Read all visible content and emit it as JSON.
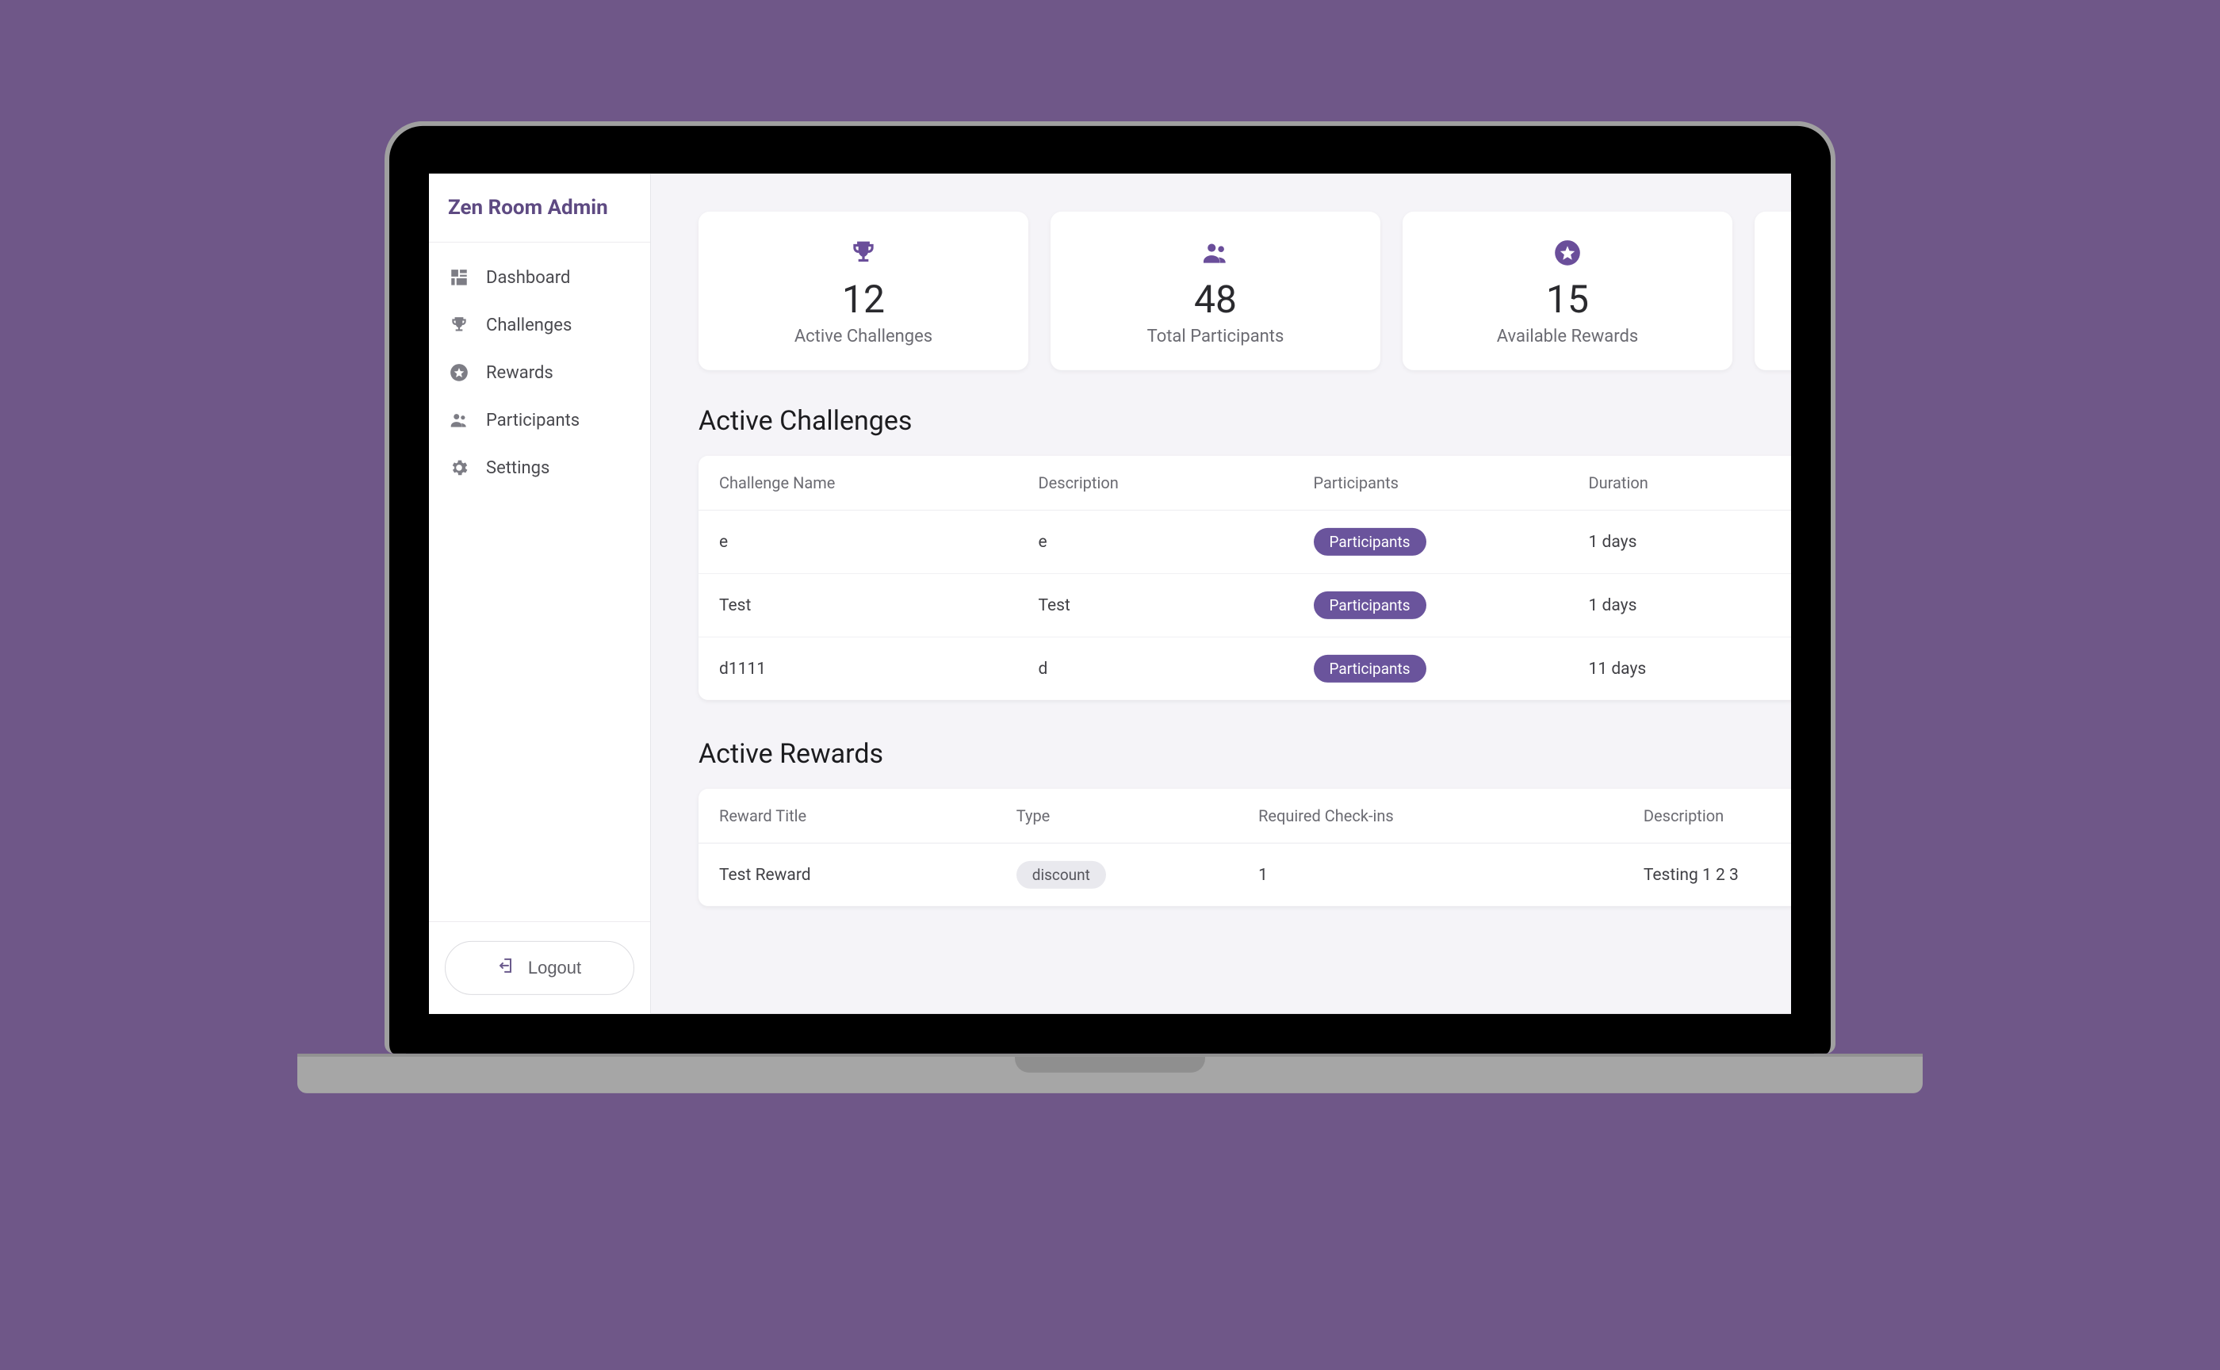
{
  "sidebar": {
    "title": "Zen Room Admin",
    "items": [
      {
        "label": "Dashboard",
        "icon": "dashboard-icon"
      },
      {
        "label": "Challenges",
        "icon": "trophy-icon"
      },
      {
        "label": "Rewards",
        "icon": "star-icon"
      },
      {
        "label": "Participants",
        "icon": "users-icon"
      },
      {
        "label": "Settings",
        "icon": "gear-icon"
      }
    ],
    "logout_label": "Logout"
  },
  "stats": [
    {
      "value": "12",
      "label": "Active Challenges",
      "icon": "trophy-icon"
    },
    {
      "value": "48",
      "label": "Total Participants",
      "icon": "users-icon"
    },
    {
      "value": "15",
      "label": "Available Rewards",
      "icon": "star-icon"
    }
  ],
  "challenges_section": {
    "title": "Active Challenges",
    "columns": {
      "name": "Challenge Name",
      "description": "Description",
      "participants": "Participants",
      "duration": "Duration"
    },
    "rows": [
      {
        "name": "e",
        "description": "e",
        "participants_label": "Participants",
        "duration": "1 days"
      },
      {
        "name": "Test",
        "description": "Test",
        "participants_label": "Participants",
        "duration": "1 days"
      },
      {
        "name": "d1111",
        "description": "d",
        "participants_label": "Participants",
        "duration": "11 days"
      }
    ]
  },
  "rewards_section": {
    "title": "Active Rewards",
    "columns": {
      "title": "Reward Title",
      "type": "Type",
      "checkins": "Required Check-ins",
      "description": "Description"
    },
    "rows": [
      {
        "title": "Test Reward",
        "type": "discount",
        "checkins": "1",
        "description": "Testing 1 2 3"
      }
    ]
  }
}
